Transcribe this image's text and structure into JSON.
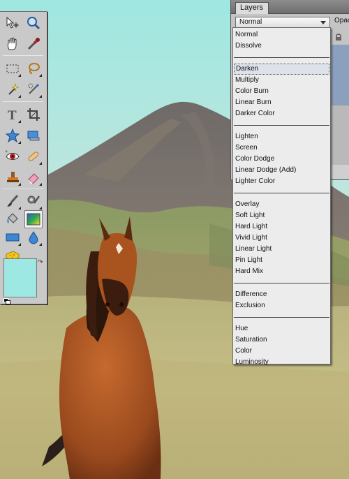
{
  "layers_panel": {
    "tab_label": "Layers",
    "blend_mode_value": "Normal",
    "opacity_label": "Opac"
  },
  "blend_menu": {
    "groups": [
      [
        "Normal",
        "Dissolve"
      ],
      [
        "Darken",
        "Multiply",
        "Color Burn",
        "Linear Burn",
        "Darker Color"
      ],
      [
        "Lighten",
        "Screen",
        "Color Dodge",
        "Linear Dodge (Add)",
        "Lighter Color"
      ],
      [
        "Overlay",
        "Soft Light",
        "Hard Light",
        "Vivid Light",
        "Linear Light",
        "Pin Light",
        "Hard Mix"
      ],
      [
        "Difference",
        "Exclusion"
      ],
      [
        "Hue",
        "Saturation",
        "Color",
        "Luminosity"
      ]
    ],
    "highlighted_item": "Darken"
  },
  "toolbox": {
    "tools": [
      "move-tool-icon",
      "zoom-tool-icon",
      "hand-tool-icon",
      "eyedropper-tool-icon",
      "rectangular-marquee-icon",
      "lasso-tool-icon",
      "magic-wand-icon",
      "quick-selection-icon",
      "type-tool-icon",
      "crop-tool-icon",
      "custom-shape-icon",
      "cookie-cutter-icon",
      "red-eye-removal-icon",
      "spot-healing-brush-icon",
      "clone-stamp-icon",
      "eraser-tool-icon",
      "brush-tool-icon",
      "smart-brush-icon",
      "paint-bucket-icon",
      "gradient-tool-icon",
      "rectangle-shape-icon",
      "blur-tool-icon",
      "sponge-tool-icon"
    ],
    "active_tool": "gradient-tool-icon",
    "foreground_color": "#9de8e3"
  },
  "colors": {
    "panel_bg": "#c4c4c4",
    "menu_bg": "#ececec",
    "layer_highlight": "#8aa0bd",
    "sky_top": "#9de8e3"
  }
}
